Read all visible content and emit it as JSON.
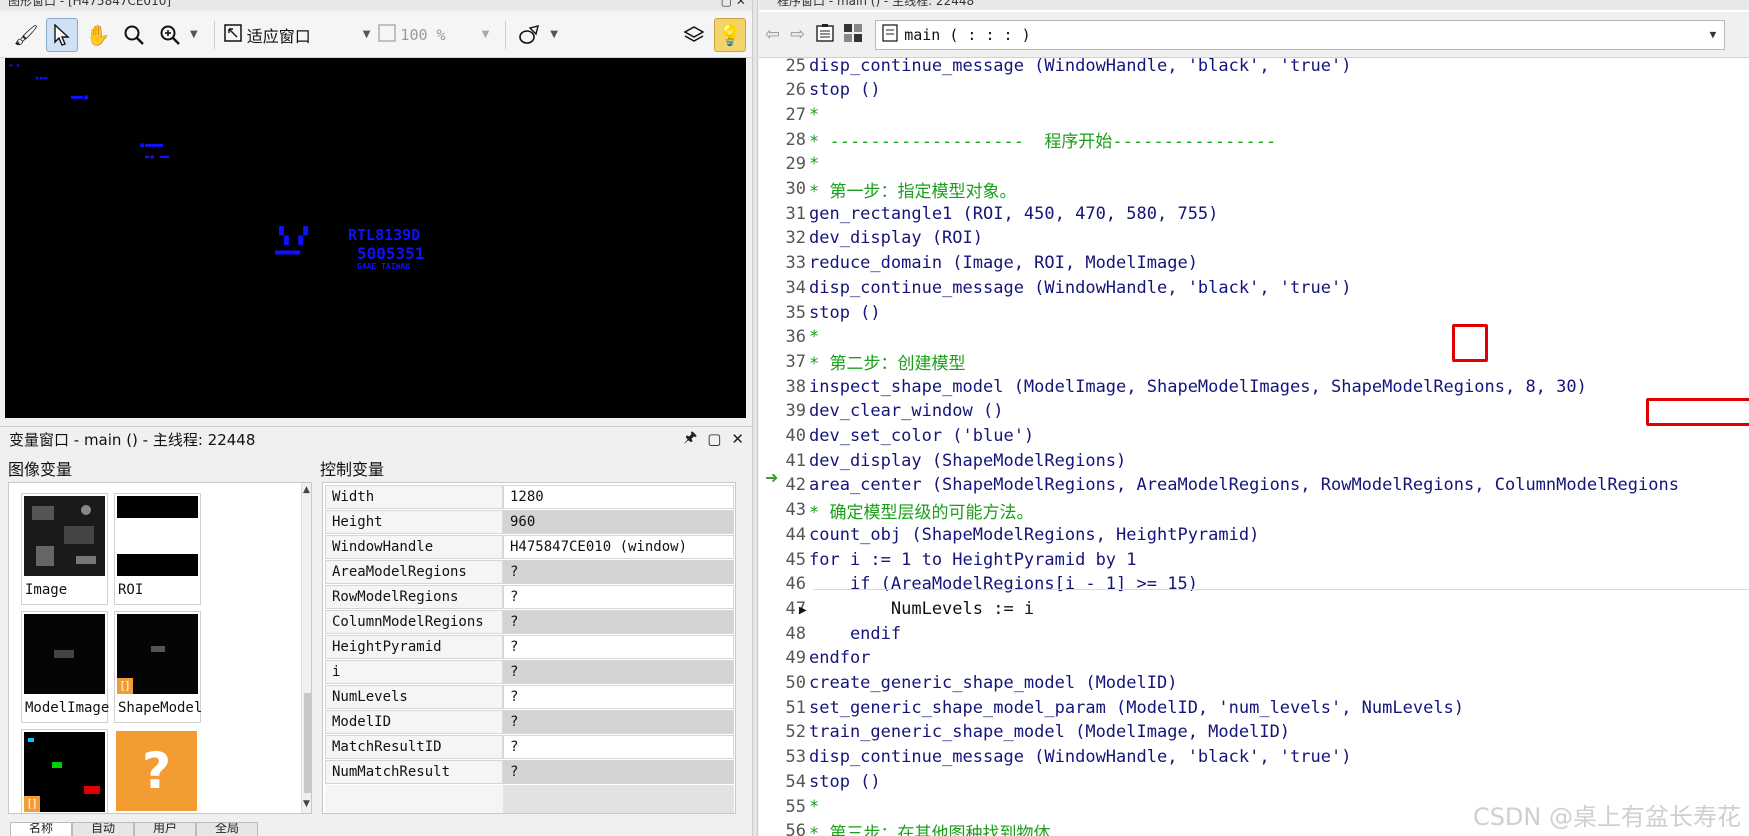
{
  "graphics_window": {
    "title": "图形窗口 - [H475847CE010]",
    "fit_label": "适应窗口",
    "zoom_label": "100 %",
    "canvas_labels": {
      "chip_line1": "RTL8139D",
      "chip_line2": "5005351",
      "chip_line3": "G4AE TAIWAN"
    }
  },
  "variable_window": {
    "title": "变量窗口 - main () - 主线程: 22448",
    "image_vars_label": "图像变量",
    "control_vars_label": "控制变量",
    "image_vars": [
      {
        "name": "Image"
      },
      {
        "name": "ROI"
      },
      {
        "name": "ModelImage"
      },
      {
        "name": "ShapeModel"
      }
    ],
    "control_vars": [
      {
        "name": "Width",
        "value": "1280"
      },
      {
        "name": "Height",
        "value": "960"
      },
      {
        "name": "WindowHandle",
        "value": "H475847CE010 (window)"
      },
      {
        "name": "AreaModelRegions",
        "value": "?"
      },
      {
        "name": "RowModelRegions",
        "value": "?"
      },
      {
        "name": "ColumnModelRegions",
        "value": "?"
      },
      {
        "name": "HeightPyramid",
        "value": "?"
      },
      {
        "name": "i",
        "value": "?"
      },
      {
        "name": "NumLevels",
        "value": "?"
      },
      {
        "name": "ModelID",
        "value": "?"
      },
      {
        "name": "MatchResultID",
        "value": "?"
      },
      {
        "name": "NumMatchResult",
        "value": "?"
      }
    ],
    "tabs": [
      "名称",
      "自动",
      "用户",
      "全局"
    ]
  },
  "program_window": {
    "title": "程序窗口 - main () - 主线程: 22448",
    "procedure_combo": "main ( : : : )",
    "lines": [
      {
        "n": "25",
        "text": "disp_continue_message (WindowHandle, 'black', 'true')",
        "kind": "kw"
      },
      {
        "n": "26",
        "text": "stop ()",
        "kind": "kw"
      },
      {
        "n": "27",
        "text": "*",
        "kind": "cm"
      },
      {
        "n": "28",
        "text": "* -------------------  程序开始----------------",
        "kind": "cm"
      },
      {
        "n": "29",
        "text": "*",
        "kind": "cm"
      },
      {
        "n": "30",
        "text": "* 第一步：指定模型对象。",
        "kind": "cm"
      },
      {
        "n": "31",
        "text": "gen_rectangle1 (ROI, 450, 470, 580, 755)",
        "kind": "kw"
      },
      {
        "n": "32",
        "text": "dev_display (ROI)",
        "kind": "kw"
      },
      {
        "n": "33",
        "text": "reduce_domain (Image, ROI, ModelImage)",
        "kind": "kw"
      },
      {
        "n": "34",
        "text": "disp_continue_message (WindowHandle, 'black', 'true')",
        "kind": "kw"
      },
      {
        "n": "35",
        "text": "stop ()",
        "kind": "kw"
      },
      {
        "n": "36",
        "text": "*",
        "kind": "cm"
      },
      {
        "n": "37",
        "text": "* 第二步：创建模型",
        "kind": "cm"
      },
      {
        "n": "38",
        "text": "inspect_shape_model (ModelImage, ShapeModelImages, ShapeModelRegions, 8, 30)",
        "kind": "kw"
      },
      {
        "n": "39",
        "text": "dev_clear_window ()",
        "kind": "kw"
      },
      {
        "n": "40",
        "text": "dev_set_color ('blue')",
        "kind": "kw"
      },
      {
        "n": "41",
        "text": "dev_display (ShapeModelRegions)",
        "kind": "kw"
      },
      {
        "n": "42",
        "text": "area_center (ShapeModelRegions, AreaModelRegions, RowModelRegions, ColumnModelRegions",
        "kind": "kw"
      },
      {
        "n": "43",
        "text": "* 确定模型层级的可能方法。",
        "kind": "cm"
      },
      {
        "n": "44",
        "text": "count_obj (ShapeModelRegions, HeightPyramid)",
        "kind": "kw"
      },
      {
        "n": "45",
        "text": "for i := 1 to HeightPyramid by 1",
        "kind": "kw"
      },
      {
        "n": "46",
        "text": "    if (AreaModelRegions[i - 1] >= 15)",
        "kind": "kw"
      },
      {
        "n": "47",
        "text": "        NumLevels := i",
        "kind": "op"
      },
      {
        "n": "48",
        "text": "    endif",
        "kind": "kw"
      },
      {
        "n": "49",
        "text": "endfor",
        "kind": "kw"
      },
      {
        "n": "50",
        "text": "create_generic_shape_model (ModelID)",
        "kind": "kw"
      },
      {
        "n": "51",
        "text": "set_generic_shape_model_param (ModelID, 'num_levels', NumLevels)",
        "kind": "kw"
      },
      {
        "n": "52",
        "text": "train_generic_shape_model (ModelImage, ModelID)",
        "kind": "kw"
      },
      {
        "n": "53",
        "text": "disp_continue_message (WindowHandle, 'black', 'true')",
        "kind": "kw"
      },
      {
        "n": "54",
        "text": "stop ()",
        "kind": "kw"
      },
      {
        "n": "55",
        "text": "*",
        "kind": "cm"
      },
      {
        "n": "56",
        "text": "* 第三步：在其他图种找到物体",
        "kind": "cm"
      }
    ],
    "watermark": "CSDN @桌上有盆长寿花"
  },
  "colors": {
    "code_keyword": "#14147a",
    "code_comment": "#1aa01a",
    "highlight_box": "#e00000",
    "canvas_text": "#1010ff",
    "pc_arrow": "#3aa02c"
  }
}
